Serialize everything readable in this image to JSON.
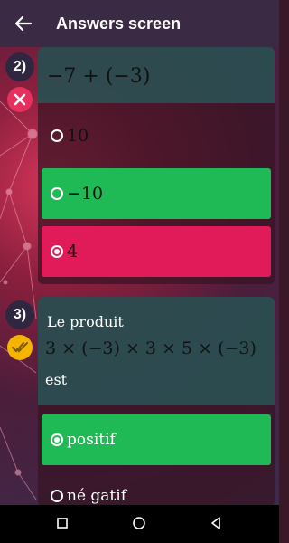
{
  "appbar": {
    "title": "Answers screen",
    "back_icon": "arrow-left-icon"
  },
  "questions": [
    {
      "number": "2)",
      "status_icon": "cross-icon",
      "expression": "−7 + (−3)",
      "options": [
        {
          "label": "10",
          "selected": false,
          "state": "neutral"
        },
        {
          "label": "−10",
          "selected": false,
          "state": "correct"
        },
        {
          "label": "4",
          "selected": true,
          "state": "wrong"
        }
      ]
    },
    {
      "number": "3)",
      "status_icon": "double-check-icon",
      "line1": "Le produit",
      "expression": "3 × (−3) × 3 × 5 × (−3)",
      "line3": "est",
      "options": [
        {
          "label": "positif",
          "selected": true,
          "state": "correct"
        },
        {
          "label": "né gatif",
          "selected": false,
          "state": "neutral"
        }
      ]
    }
  ],
  "navbar": {
    "recent_icon": "square-icon",
    "home_icon": "circle-icon",
    "back_icon": "triangle-back-icon"
  },
  "colors": {
    "correct": "#1fba55",
    "wrong": "#e11b5a",
    "appbar": "#3a2a44",
    "cross_badge": "#e6315f",
    "check_badge": "#f4b400"
  }
}
